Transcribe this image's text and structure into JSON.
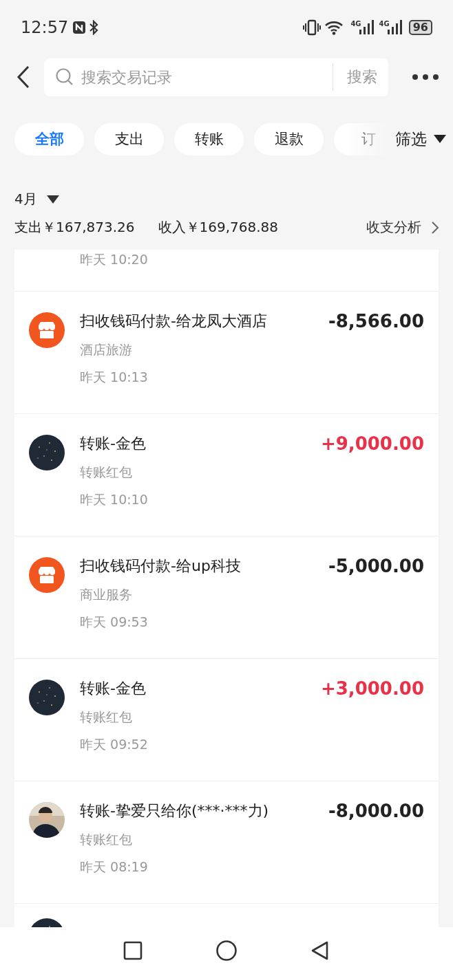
{
  "status_bar": {
    "time": "12:57",
    "network": [
      "4G",
      "4G"
    ],
    "battery": "96"
  },
  "header": {
    "search": {
      "placeholder": "搜索交易记录"
    },
    "search_button": "搜索"
  },
  "tabs": [
    {
      "label": "全部",
      "selected": true
    },
    {
      "label": "支出",
      "selected": false
    },
    {
      "label": "转账",
      "selected": false
    },
    {
      "label": "退款",
      "selected": false
    },
    {
      "label": "订",
      "selected": false
    }
  ],
  "filter": "筛选",
  "month": "4月",
  "summary": {
    "expense": "支出￥167,873.26",
    "income": "收入￥169,768.88",
    "analysis": "收支分析"
  },
  "transactions": [
    {
      "time": "昨天 10:20"
    },
    {
      "kind": "merchant",
      "title": "扫收钱码付款-给龙凤大酒店",
      "category": "酒店旅游",
      "time": "昨天 10:13",
      "amount": "-8,566.00",
      "income": false
    },
    {
      "kind": "contact",
      "title": "转账-金色",
      "category": "转账红包",
      "time": "昨天 10:10",
      "amount": "+9,000.00",
      "income": true
    },
    {
      "kind": "merchant",
      "title": "扫收钱码付款-给up科技",
      "category": "商业服务",
      "time": "昨天 09:53",
      "amount": "-5,000.00",
      "income": false
    },
    {
      "kind": "contact",
      "title": "转账-金色",
      "category": "转账红包",
      "time": "昨天 09:52",
      "amount": "+3,000.00",
      "income": true
    },
    {
      "kind": "person",
      "title": "转账-挚爱只给你(***·***力)",
      "category": "转账红包",
      "time": "昨天 08:19",
      "amount": "-8,000.00",
      "income": false
    },
    {
      "kind": "contact"
    }
  ]
}
